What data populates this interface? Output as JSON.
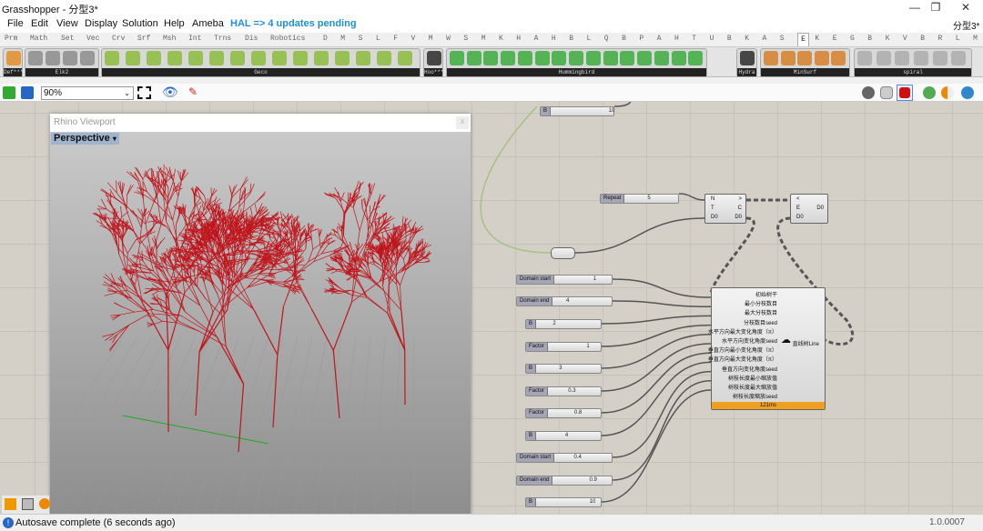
{
  "window": {
    "title": "Grasshopper - 分型3*",
    "doc_label": "分型3*",
    "controls": [
      "—",
      "❐",
      "✕"
    ]
  },
  "menu": [
    "File",
    "Edit",
    "View",
    "Display",
    "Solution",
    "Help",
    "Ameba"
  ],
  "hal_notice": "HAL => 4 updates pending",
  "tabs": [
    "Prm",
    "Math",
    "Set",
    "Vec",
    "Crv",
    "Srf",
    "Msh",
    "Int",
    "Trns",
    "Dis",
    "Robotics",
    "D",
    "M",
    "S",
    "L",
    "F",
    "V",
    "M",
    "W",
    "S",
    "M",
    "K",
    "H",
    "A",
    "H",
    "B",
    "L",
    "Q",
    "B",
    "P",
    "A",
    "H",
    "T",
    "U",
    "B",
    "K",
    "A",
    "S",
    "E",
    "K",
    "E",
    "G",
    "B",
    "K",
    "V",
    "B",
    "R",
    "L",
    "M",
    "H"
  ],
  "active_tab": "E",
  "ribbon_groups": [
    "Def***",
    "Elk2",
    "Geco",
    "Hoo***",
    "Hummingbird",
    "Hydra",
    "MinSurf",
    "spiral"
  ],
  "toolbar": {
    "zoom": "90%"
  },
  "viewport": {
    "title": "Rhino Viewport",
    "view": "Perspective",
    "close": "x"
  },
  "sliders": [
    {
      "name": "B",
      "value": "10"
    },
    {
      "name": "Repeat",
      "value": "5"
    },
    {
      "name": "Domain start",
      "value": "1"
    },
    {
      "name": "Domain end",
      "value": "4"
    },
    {
      "name": "B",
      "value": "2"
    },
    {
      "name": "Factor",
      "value": "1"
    },
    {
      "name": "B",
      "value": "3"
    },
    {
      "name": "Factor",
      "value": "0.3"
    },
    {
      "name": "Factor",
      "value": "0.8"
    },
    {
      "name": "B",
      "value": "4"
    },
    {
      "name": "Domain start",
      "value": "0.4"
    },
    {
      "name": "Domain end",
      "value": "0.9"
    },
    {
      "name": "B",
      "value": "10"
    }
  ],
  "loop_start": {
    "inputs": [
      "N",
      "T",
      "D0"
    ],
    "outputs": [
      ">",
      "C",
      "D0"
    ]
  },
  "loop_end": {
    "inputs": [
      "<",
      "E",
      "D0"
    ],
    "outputs": [
      "D0"
    ]
  },
  "component": {
    "inputs": [
      "初始树干",
      "最小分枝数目",
      "最大分枝数目",
      "分枝数目seed",
      "水平方向最大变化角度（π）",
      "水平方向变化角度seed",
      "垂直方向最小变化角度（π）",
      "垂直方向最大变化角度（π）",
      "垂直方向变化角度seed",
      "树枝长度最小缩放值",
      "树枝长度最大缩放值",
      "树枝长度缩放seed"
    ],
    "output": "直线树Line",
    "timing": "121ms"
  },
  "colors": {
    "canvas": "#d4d0c8",
    "trees": "#c0141c",
    "timing_bar": "#f0a020",
    "hal": "#1e90d8"
  },
  "status": {
    "message": "Autosave complete (6 seconds ago)",
    "version": "1.0.0007"
  }
}
